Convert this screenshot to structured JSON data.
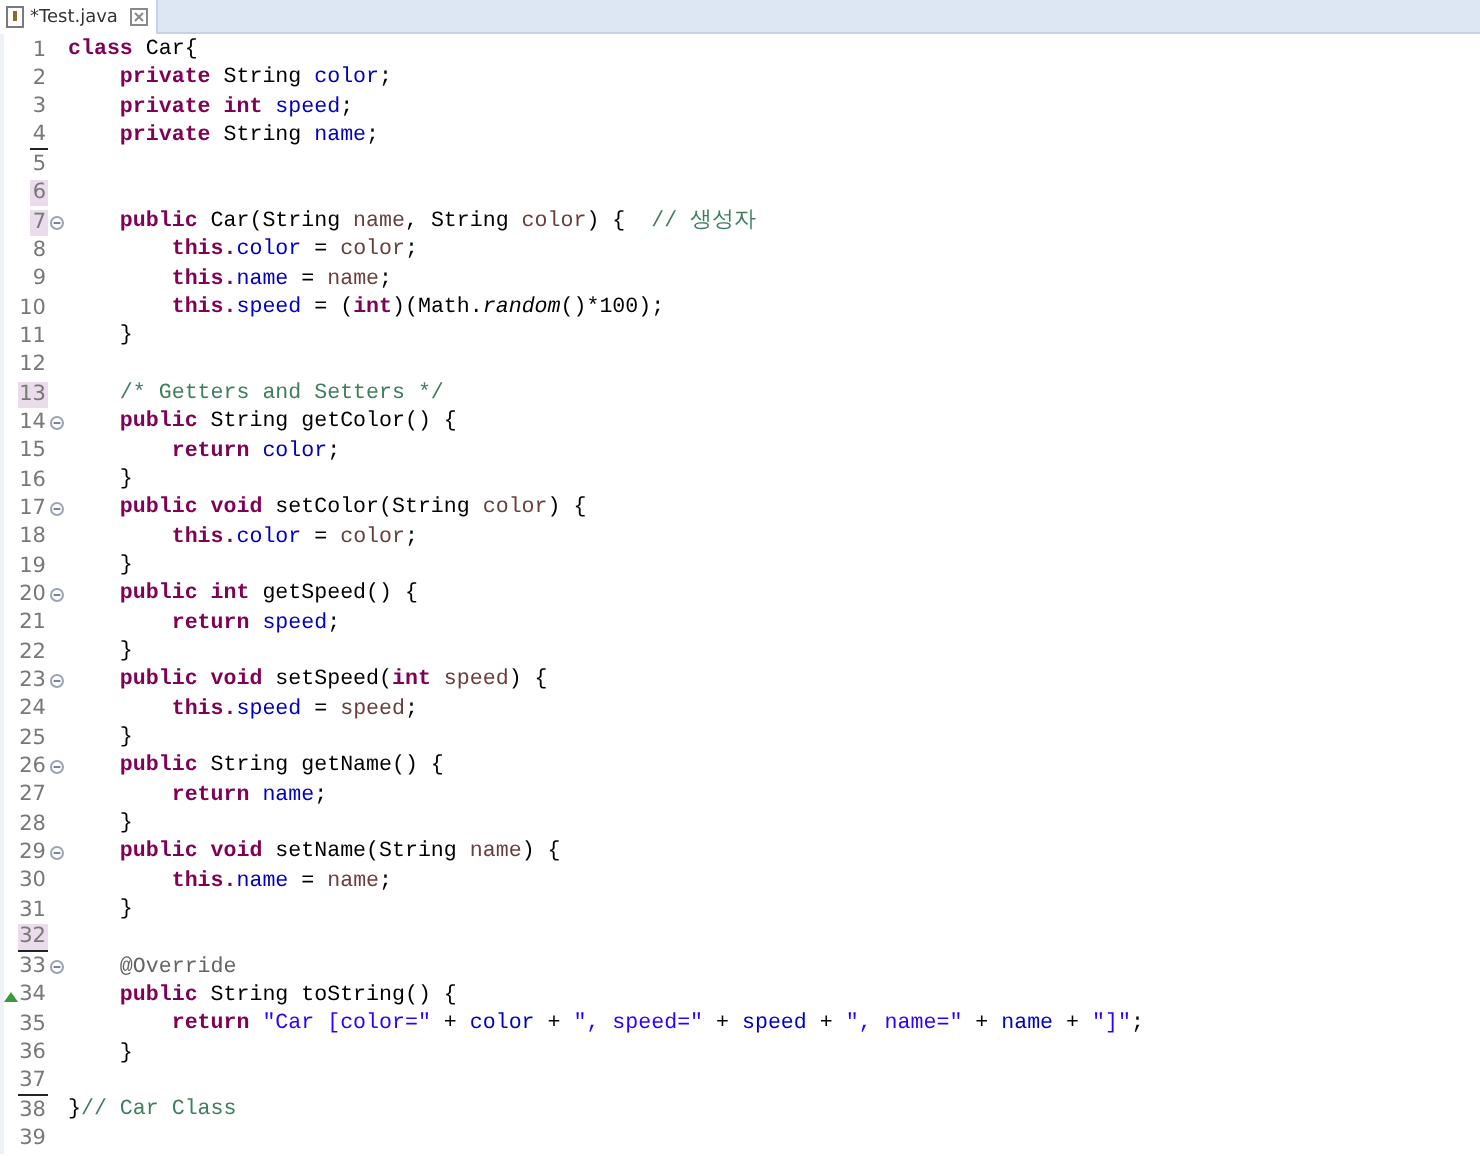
{
  "tab": {
    "title": "*Test.java",
    "selected": true
  },
  "lines": [
    {
      "number": "1",
      "highlighted": false,
      "underlined": false,
      "collapsible": false,
      "overrides": false,
      "tokens": [
        {
          "kind": "kw",
          "text": "class"
        },
        {
          "kind": "plain",
          "text": " Car{"
        }
      ]
    },
    {
      "number": "2",
      "highlighted": false,
      "underlined": false,
      "collapsible": false,
      "overrides": false,
      "tokens": [
        {
          "kind": "kw",
          "text": "    private"
        },
        {
          "kind": "plain",
          "text": " String"
        },
        {
          "kind": "field",
          "text": " color"
        },
        {
          "kind": "plain",
          "text": ";"
        }
      ]
    },
    {
      "number": "3",
      "highlighted": false,
      "underlined": false,
      "collapsible": false,
      "overrides": false,
      "tokens": [
        {
          "kind": "kw",
          "text": "    private int"
        },
        {
          "kind": "field",
          "text": " speed"
        },
        {
          "kind": "plain",
          "text": ";"
        }
      ]
    },
    {
      "number": "4",
      "highlighted": false,
      "underlined": true,
      "collapsible": false,
      "overrides": false,
      "tokens": [
        {
          "kind": "kw",
          "text": "    private"
        },
        {
          "kind": "plain",
          "text": " String"
        },
        {
          "kind": "field",
          "text": " name"
        },
        {
          "kind": "plain",
          "text": ";"
        }
      ]
    },
    {
      "number": "5",
      "highlighted": false,
      "underlined": false,
      "collapsible": false,
      "overrides": false
    },
    {
      "number": "6",
      "highlighted": true,
      "underlined": false,
      "collapsible": false,
      "overrides": false
    },
    {
      "number": "7",
      "highlighted": true,
      "underlined": false,
      "collapsible": true,
      "overrides": false,
      "tokens": [
        {
          "kind": "kw",
          "text": "    public"
        },
        {
          "kind": "plain",
          "text": " Car(String"
        },
        {
          "kind": "param",
          "text": " name"
        },
        {
          "kind": "plain",
          "text": ", String"
        },
        {
          "kind": "param",
          "text": " color"
        },
        {
          "kind": "plain",
          "text": ") {"
        },
        {
          "kind": "comment",
          "text": "  // 생성자"
        }
      ]
    },
    {
      "number": "8",
      "highlighted": false,
      "underlined": false,
      "collapsible": false,
      "overrides": false,
      "tokens": [
        {
          "kind": "kw",
          "text": "        this."
        },
        {
          "kind": "field",
          "text": "color"
        },
        {
          "kind": "plain",
          "text": " ="
        },
        {
          "kind": "param",
          "text": " color"
        },
        {
          "kind": "plain",
          "text": ";"
        }
      ]
    },
    {
      "number": "9",
      "highlighted": false,
      "underlined": false,
      "collapsible": false,
      "overrides": false,
      "tokens": [
        {
          "kind": "kw",
          "text": "        this."
        },
        {
          "kind": "field",
          "text": "name"
        },
        {
          "kind": "plain",
          "text": " ="
        },
        {
          "kind": "param",
          "text": " name"
        },
        {
          "kind": "plain",
          "text": ";"
        }
      ]
    },
    {
      "number": "10",
      "highlighted": false,
      "underlined": false,
      "collapsible": false,
      "overrides": false,
      "tokens": [
        {
          "kind": "kw",
          "text": "        this."
        },
        {
          "kind": "field",
          "text": "speed"
        },
        {
          "kind": "plain",
          "text": " = ("
        },
        {
          "kind": "kw",
          "text": "int"
        },
        {
          "kind": "plain",
          "text": ")(Math."
        },
        {
          "kind": "static",
          "text": "random"
        },
        {
          "kind": "plain",
          "text": "()*100);"
        }
      ]
    },
    {
      "number": "11",
      "highlighted": false,
      "underlined": false,
      "collapsible": false,
      "overrides": false,
      "tokens": [
        {
          "kind": "plain",
          "text": "    }"
        }
      ]
    },
    {
      "number": "12",
      "highlighted": false,
      "underlined": false,
      "collapsible": false,
      "overrides": false
    },
    {
      "number": "13",
      "highlighted": true,
      "underlined": false,
      "collapsible": false,
      "overrides": false,
      "tokens": [
        {
          "kind": "comment",
          "text": "    /* Getters and Setters */"
        }
      ]
    },
    {
      "number": "14",
      "highlighted": false,
      "underlined": false,
      "collapsible": true,
      "overrides": false,
      "tokens": [
        {
          "kind": "kw",
          "text": "    public"
        },
        {
          "kind": "plain",
          "text": " String getColor() {"
        }
      ]
    },
    {
      "number": "15",
      "highlighted": false,
      "underlined": false,
      "collapsible": false,
      "overrides": false,
      "tokens": [
        {
          "kind": "kw",
          "text": "        return"
        },
        {
          "kind": "field",
          "text": " color"
        },
        {
          "kind": "plain",
          "text": ";"
        }
      ]
    },
    {
      "number": "16",
      "highlighted": false,
      "underlined": false,
      "collapsible": false,
      "overrides": false,
      "tokens": [
        {
          "kind": "plain",
          "text": "    }"
        }
      ]
    },
    {
      "number": "17",
      "highlighted": false,
      "underlined": false,
      "collapsible": true,
      "overrides": false,
      "tokens": [
        {
          "kind": "kw",
          "text": "    public void"
        },
        {
          "kind": "plain",
          "text": " setColor(String"
        },
        {
          "kind": "param",
          "text": " color"
        },
        {
          "kind": "plain",
          "text": ") {"
        }
      ]
    },
    {
      "number": "18",
      "highlighted": false,
      "underlined": false,
      "collapsible": false,
      "overrides": false,
      "tokens": [
        {
          "kind": "kw",
          "text": "        this."
        },
        {
          "kind": "field",
          "text": "color"
        },
        {
          "kind": "plain",
          "text": " ="
        },
        {
          "kind": "param",
          "text": " color"
        },
        {
          "kind": "plain",
          "text": ";"
        }
      ]
    },
    {
      "number": "19",
      "highlighted": false,
      "underlined": false,
      "collapsible": false,
      "overrides": false,
      "tokens": [
        {
          "kind": "plain",
          "text": "    }"
        }
      ]
    },
    {
      "number": "20",
      "highlighted": false,
      "underlined": false,
      "collapsible": true,
      "overrides": false,
      "tokens": [
        {
          "kind": "kw",
          "text": "    public int"
        },
        {
          "kind": "plain",
          "text": " getSpeed() {"
        }
      ]
    },
    {
      "number": "21",
      "highlighted": false,
      "underlined": false,
      "collapsible": false,
      "overrides": false,
      "tokens": [
        {
          "kind": "kw",
          "text": "        return"
        },
        {
          "kind": "field",
          "text": " speed"
        },
        {
          "kind": "plain",
          "text": ";"
        }
      ]
    },
    {
      "number": "22",
      "highlighted": false,
      "underlined": false,
      "collapsible": false,
      "overrides": false,
      "tokens": [
        {
          "kind": "plain",
          "text": "    }"
        }
      ]
    },
    {
      "number": "23",
      "highlighted": false,
      "underlined": false,
      "collapsible": true,
      "overrides": false,
      "tokens": [
        {
          "kind": "kw",
          "text": "    public void"
        },
        {
          "kind": "plain",
          "text": " setSpeed("
        },
        {
          "kind": "kw",
          "text": "int"
        },
        {
          "kind": "param",
          "text": " speed"
        },
        {
          "kind": "plain",
          "text": ") {"
        }
      ]
    },
    {
      "number": "24",
      "highlighted": false,
      "underlined": false,
      "collapsible": false,
      "overrides": false,
      "tokens": [
        {
          "kind": "kw",
          "text": "        this."
        },
        {
          "kind": "field",
          "text": "speed"
        },
        {
          "kind": "plain",
          "text": " ="
        },
        {
          "kind": "param",
          "text": " speed"
        },
        {
          "kind": "plain",
          "text": ";"
        }
      ]
    },
    {
      "number": "25",
      "highlighted": false,
      "underlined": false,
      "collapsible": false,
      "overrides": false,
      "tokens": [
        {
          "kind": "plain",
          "text": "    }"
        }
      ]
    },
    {
      "number": "26",
      "highlighted": false,
      "underlined": false,
      "collapsible": true,
      "overrides": false,
      "tokens": [
        {
          "kind": "kw",
          "text": "    public"
        },
        {
          "kind": "plain",
          "text": " String getName() {"
        }
      ]
    },
    {
      "number": "27",
      "highlighted": false,
      "underlined": false,
      "collapsible": false,
      "overrides": false,
      "tokens": [
        {
          "kind": "kw",
          "text": "        return"
        },
        {
          "kind": "field",
          "text": " name"
        },
        {
          "kind": "plain",
          "text": ";"
        }
      ]
    },
    {
      "number": "28",
      "highlighted": false,
      "underlined": false,
      "collapsible": false,
      "overrides": false,
      "tokens": [
        {
          "kind": "plain",
          "text": "    }"
        }
      ]
    },
    {
      "number": "29",
      "highlighted": false,
      "underlined": false,
      "collapsible": true,
      "overrides": false,
      "tokens": [
        {
          "kind": "kw",
          "text": "    public void"
        },
        {
          "kind": "plain",
          "text": " setName(String"
        },
        {
          "kind": "param",
          "text": " name"
        },
        {
          "kind": "plain",
          "text": ") {"
        }
      ]
    },
    {
      "number": "30",
      "highlighted": false,
      "underlined": false,
      "collapsible": false,
      "overrides": false,
      "tokens": [
        {
          "kind": "kw",
          "text": "        this."
        },
        {
          "kind": "field",
          "text": "name"
        },
        {
          "kind": "plain",
          "text": " ="
        },
        {
          "kind": "param",
          "text": " name"
        },
        {
          "kind": "plain",
          "text": ";"
        }
      ]
    },
    {
      "number": "31",
      "highlighted": false,
      "underlined": false,
      "collapsible": false,
      "overrides": false,
      "tokens": [
        {
          "kind": "plain",
          "text": "    }"
        }
      ]
    },
    {
      "number": "32",
      "highlighted": true,
      "underlined": true,
      "collapsible": false,
      "overrides": false
    },
    {
      "number": "33",
      "highlighted": false,
      "underlined": false,
      "collapsible": true,
      "overrides": false,
      "tokens": [
        {
          "kind": "annotation",
          "text": "    @Override"
        }
      ]
    },
    {
      "number": "34",
      "highlighted": false,
      "underlined": false,
      "collapsible": false,
      "overrides": true,
      "tokens": [
        {
          "kind": "kw",
          "text": "    public"
        },
        {
          "kind": "plain",
          "text": " String toString() {"
        }
      ]
    },
    {
      "number": "35",
      "highlighted": false,
      "underlined": false,
      "collapsible": false,
      "overrides": false,
      "tokens": [
        {
          "kind": "kw",
          "text": "        return"
        },
        {
          "kind": "string",
          "text": " \"Car [color=\""
        },
        {
          "kind": "plain",
          "text": " +"
        },
        {
          "kind": "field",
          "text": " color"
        },
        {
          "kind": "plain",
          "text": " +"
        },
        {
          "kind": "string",
          "text": " \", speed=\""
        },
        {
          "kind": "plain",
          "text": " +"
        },
        {
          "kind": "field",
          "text": " speed"
        },
        {
          "kind": "plain",
          "text": " +"
        },
        {
          "kind": "string",
          "text": " \", name=\""
        },
        {
          "kind": "plain",
          "text": " +"
        },
        {
          "kind": "field",
          "text": " name"
        },
        {
          "kind": "plain",
          "text": " +"
        },
        {
          "kind": "string",
          "text": " \"]\""
        },
        {
          "kind": "plain",
          "text": ";"
        }
      ]
    },
    {
      "number": "36",
      "highlighted": false,
      "underlined": false,
      "collapsible": false,
      "overrides": false,
      "tokens": [
        {
          "kind": "plain",
          "text": "    }"
        }
      ]
    },
    {
      "number": "37",
      "highlighted": false,
      "underlined": true,
      "collapsible": false,
      "overrides": false
    },
    {
      "number": "38",
      "highlighted": false,
      "underlined": false,
      "collapsible": false,
      "overrides": false,
      "tokens": [
        {
          "kind": "plain",
          "text": "}"
        },
        {
          "kind": "comment",
          "text": "// Car Class"
        }
      ]
    },
    {
      "number": "39",
      "highlighted": false,
      "underlined": false,
      "collapsible": false,
      "overrides": false
    }
  ]
}
